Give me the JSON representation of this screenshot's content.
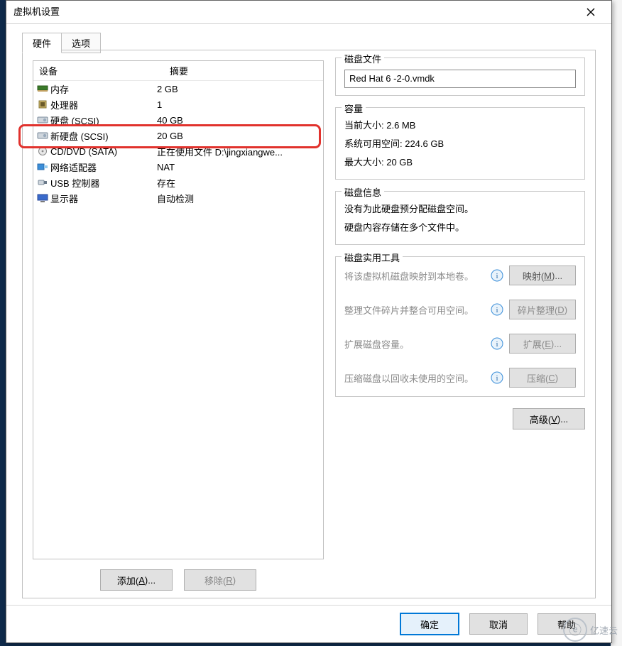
{
  "window": {
    "title": "虚拟机设置"
  },
  "tabs": {
    "hardware": "硬件",
    "options": "选项"
  },
  "deviceList": {
    "header_device": "设备",
    "header_summary": "摘要",
    "items": [
      {
        "name": "内存",
        "summary": "2 GB",
        "icon": "memory-icon"
      },
      {
        "name": "处理器",
        "summary": "1",
        "icon": "cpu-icon"
      },
      {
        "name": "硬盘 (SCSI)",
        "summary": "40 GB",
        "icon": "disk-icon"
      },
      {
        "name": "新硬盘 (SCSI)",
        "summary": "20 GB",
        "icon": "disk-icon"
      },
      {
        "name": "CD/DVD (SATA)",
        "summary": "正在使用文件 D:\\jingxiangwe...",
        "icon": "cd-icon"
      },
      {
        "name": "网络适配器",
        "summary": "NAT",
        "icon": "nic-icon"
      },
      {
        "name": "USB 控制器",
        "summary": "存在",
        "icon": "usb-icon"
      },
      {
        "name": "显示器",
        "summary": "自动检测",
        "icon": "display-icon"
      }
    ]
  },
  "leftButtons": {
    "add": "添加(",
    "add_key": "A",
    "add_tail": ")...",
    "remove": "移除(",
    "remove_key": "R",
    "remove_tail": ")"
  },
  "right": {
    "diskFile": {
      "legend": "磁盘文件",
      "value": "Red Hat 6 -2-0.vmdk"
    },
    "capacity": {
      "legend": "容量",
      "current": "当前大小: 2.6 MB",
      "sysfree": "系统可用空间: 224.6 GB",
      "max": "最大大小: 20 GB"
    },
    "info": {
      "legend": "磁盘信息",
      "line1": "没有为此硬盘预分配磁盘空间。",
      "line2": "硬盘内容存储在多个文件中。"
    },
    "tools": {
      "legend": "磁盘实用工具",
      "map_desc": "将该虚拟机磁盘映射到本地卷。",
      "map_btn": "映射(",
      "map_key": "M",
      "map_tail": ")...",
      "defrag_desc": "整理文件碎片并整合可用空间。",
      "defrag_btn": "碎片整理(",
      "defrag_key": "D",
      "defrag_tail": ")",
      "expand_desc": "扩展磁盘容量。",
      "expand_btn": "扩展(",
      "expand_key": "E",
      "expand_tail": ")...",
      "compact_desc": "压缩磁盘以回收未使用的空间。",
      "compact_btn": "压缩(",
      "compact_key": "C",
      "compact_tail": ")"
    },
    "advanced": {
      "label": "高级(",
      "key": "V",
      "tail": ")..."
    }
  },
  "footer": {
    "ok": "确定",
    "cancel": "取消",
    "help": "帮助"
  },
  "watermark": {
    "symbol": "ⓔ",
    "text": "亿速云"
  }
}
